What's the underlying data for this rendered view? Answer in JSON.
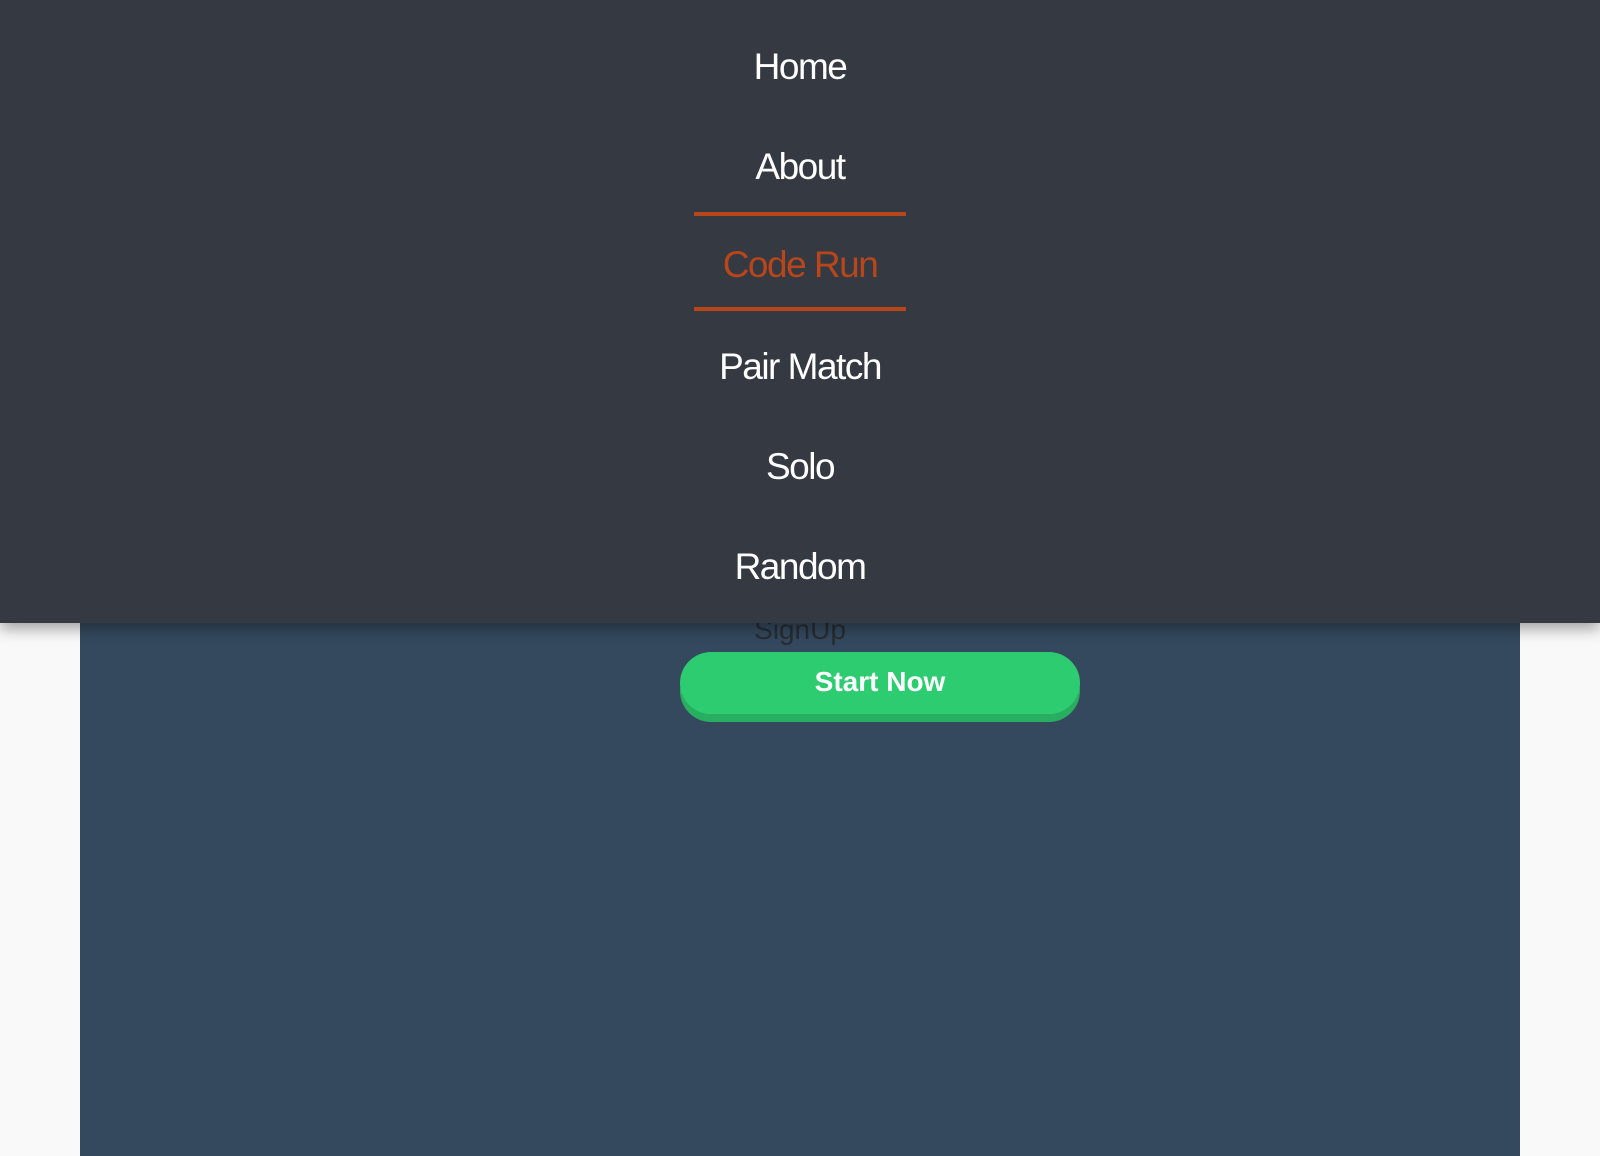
{
  "nav": {
    "items": [
      {
        "label": "Home"
      },
      {
        "label": "About"
      },
      {
        "label": "Code Run",
        "active": true
      },
      {
        "label": "Pair Match"
      },
      {
        "label": "Solo"
      },
      {
        "label": "Random"
      }
    ]
  },
  "hero": {
    "signup_label": "SignUp",
    "start_button": "Start Now"
  },
  "colors": {
    "menu_bg": "#353a42",
    "accent": "#b9461a",
    "panel_bg": "#34495e",
    "button": "#2ecc71",
    "button_shadow": "#27ae60"
  }
}
